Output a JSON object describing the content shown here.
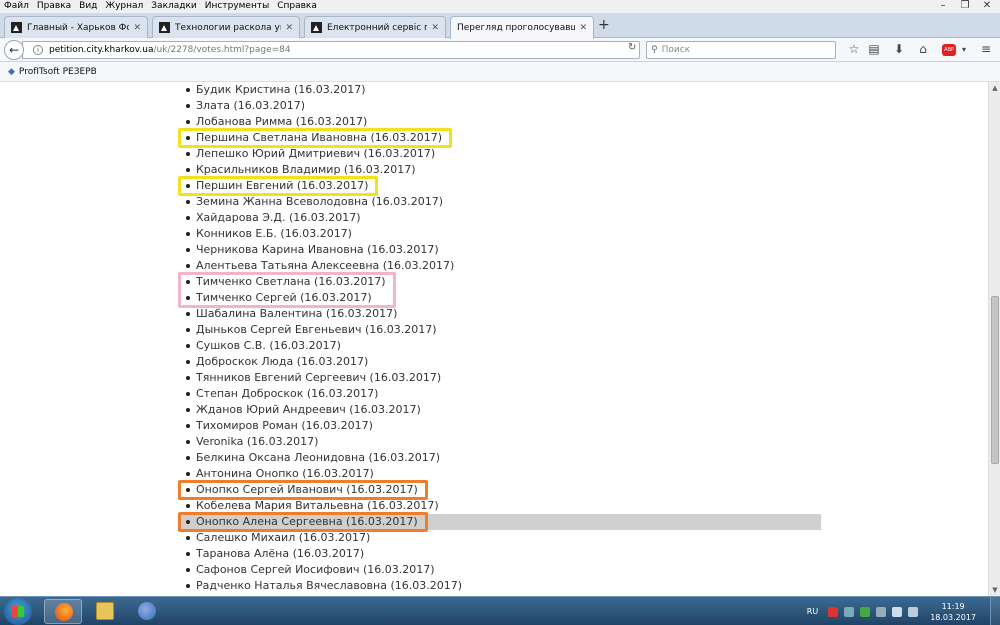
{
  "menu": [
    "Файл",
    "Правка",
    "Вид",
    "Журнал",
    "Закладки",
    "Инструменты",
    "Справка"
  ],
  "tabs": [
    {
      "label": "Главный - Харьков Форум",
      "active": false
    },
    {
      "label": "Технологии раскола укра...",
      "active": false
    },
    {
      "label": "Електронний сервіс пет...",
      "active": false
    },
    {
      "label": "Перегляд проголосувавших",
      "active": true
    }
  ],
  "address": {
    "host": "petition.city.kharkov.ua",
    "path": "/uk/2278/votes.html?page=84"
  },
  "search": {
    "placeholder": "Поиск"
  },
  "bookmarks": [
    {
      "label": "ProfITsoft РЕЗЕРВ"
    }
  ],
  "votes": [
    "Будик Кристина (16.03.2017)",
    "Злата (16.03.2017)",
    "Лобанова Римма (16.03.2017)",
    "Першина Светлана Ивановна (16.03.2017)",
    "Лепешко Юрий Дмитриевич (16.03.2017)",
    "Красильников Владимир (16.03.2017)",
    "Першин Евгений (16.03.2017)",
    "Земина Жанна Всеволодовна (16.03.2017)",
    "Хайдарова Э.Д. (16.03.2017)",
    "Конников Е.Б. (16.03.2017)",
    "Черникова Карина Ивановна (16.03.2017)",
    "Алентьева Татьяна Алексеевна (16.03.2017)",
    "Тимченко Светлана (16.03.2017)",
    "Тимченко Сергей (16.03.2017)",
    "Шабалина Валентина (16.03.2017)",
    "Дыньков Сергей Евгеньевич (16.03.2017)",
    "Сушков С.В. (16.03.2017)",
    "Доброскок Люда (16.03.2017)",
    "Тянников Евгений Сергеевич (16.03.2017)",
    "Степан Доброскок (16.03.2017)",
    "Жданов Юрий Андреевич (16.03.2017)",
    "Тихомиров Роман (16.03.2017)",
    "Veronika (16.03.2017)",
    "Белкина Оксана Леонидовна (16.03.2017)",
    "Антонина Онопко (16.03.2017)",
    "Онопко Сергей Иванович (16.03.2017)",
    "Кобелева Мария Витальевна (16.03.2017)",
    "Онопко Алена Сергеевна (16.03.2017)",
    "Салешко Михаил (16.03.2017)",
    "Таранова Алёна (16.03.2017)",
    "Сафонов Сергей Иосифович (16.03.2017)",
    "Радченко Наталья Вячеславовна (16.03.2017)"
  ],
  "highlights": [
    {
      "color": "#f2e21b",
      "rows": [
        3
      ]
    },
    {
      "color": "#f2e21b",
      "rows": [
        6
      ]
    },
    {
      "color": "#f3b3c8",
      "rows": [
        12,
        13
      ]
    },
    {
      "color": "#ef7d2a",
      "rows": [
        25
      ]
    },
    {
      "color": "#ef7d2a",
      "rows": [
        27
      ]
    }
  ],
  "selected_row": 27,
  "taskbar": {
    "lang": "RU",
    "time": "11:19",
    "date": "18.03.2017"
  }
}
